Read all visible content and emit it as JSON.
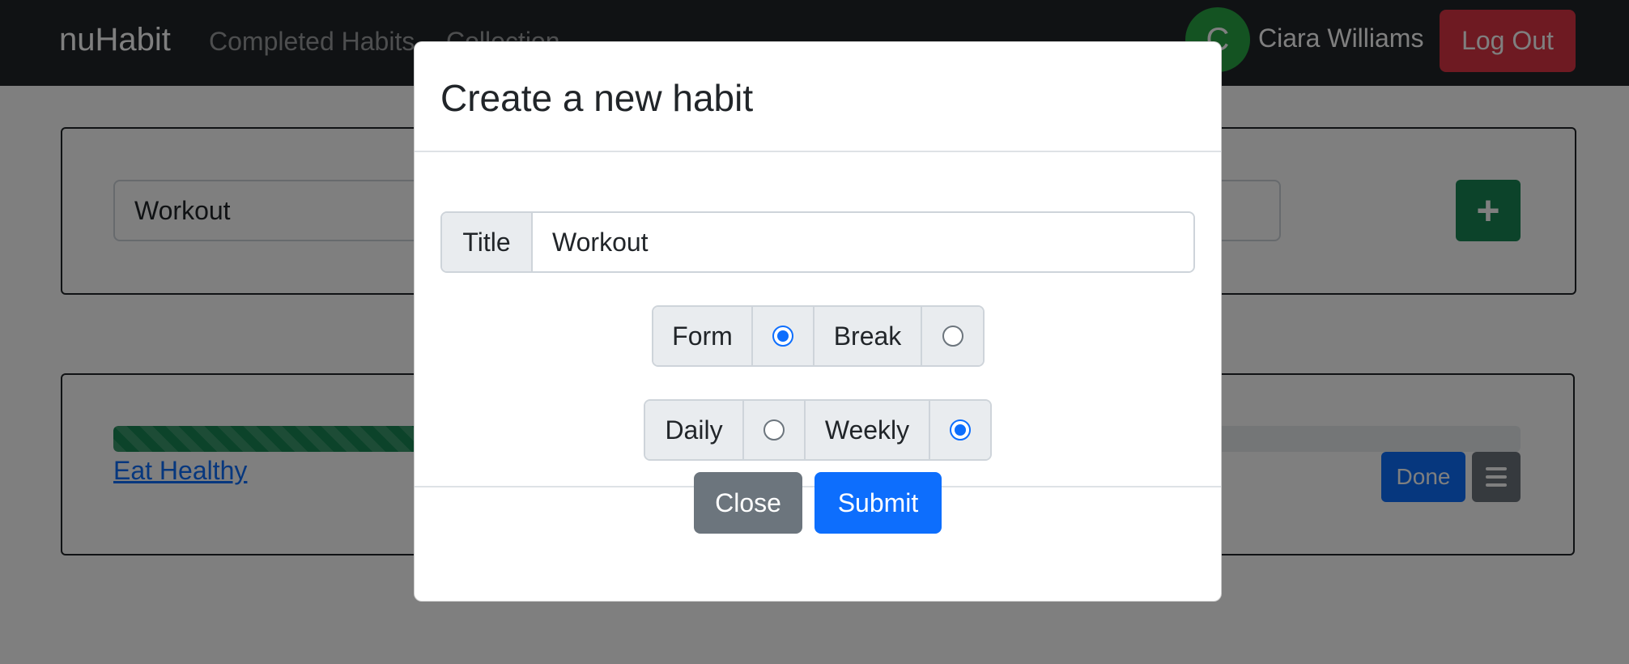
{
  "navbar": {
    "brand": "nuHabit",
    "links": [
      "Completed Habits",
      "Collection"
    ],
    "avatar_initial": "C",
    "user_name": "Ciara Williams",
    "logout_label": "Log Out"
  },
  "new_habit_card": {
    "input_value": "Workout",
    "add_button_label": "+"
  },
  "habit_list": {
    "items": [
      {
        "name": "Eat Healthy",
        "progress_percent": 22,
        "done_label": "Done",
        "menu_icon": "hamburger-icon"
      }
    ]
  },
  "modal": {
    "title": "Create a new habit",
    "title_label": "Title",
    "title_value": "Workout",
    "type_options": [
      {
        "label": "Form",
        "checked": true
      },
      {
        "label": "Break",
        "checked": false
      }
    ],
    "frequency_options": [
      {
        "label": "Daily",
        "checked": false
      },
      {
        "label": "Weekly",
        "checked": true
      }
    ],
    "close_label": "Close",
    "submit_label": "Submit"
  },
  "colors": {
    "navbar": "#212529",
    "danger": "#dc3545",
    "success": "#198754",
    "primary": "#0d6efd",
    "secondary": "#6c757d"
  }
}
